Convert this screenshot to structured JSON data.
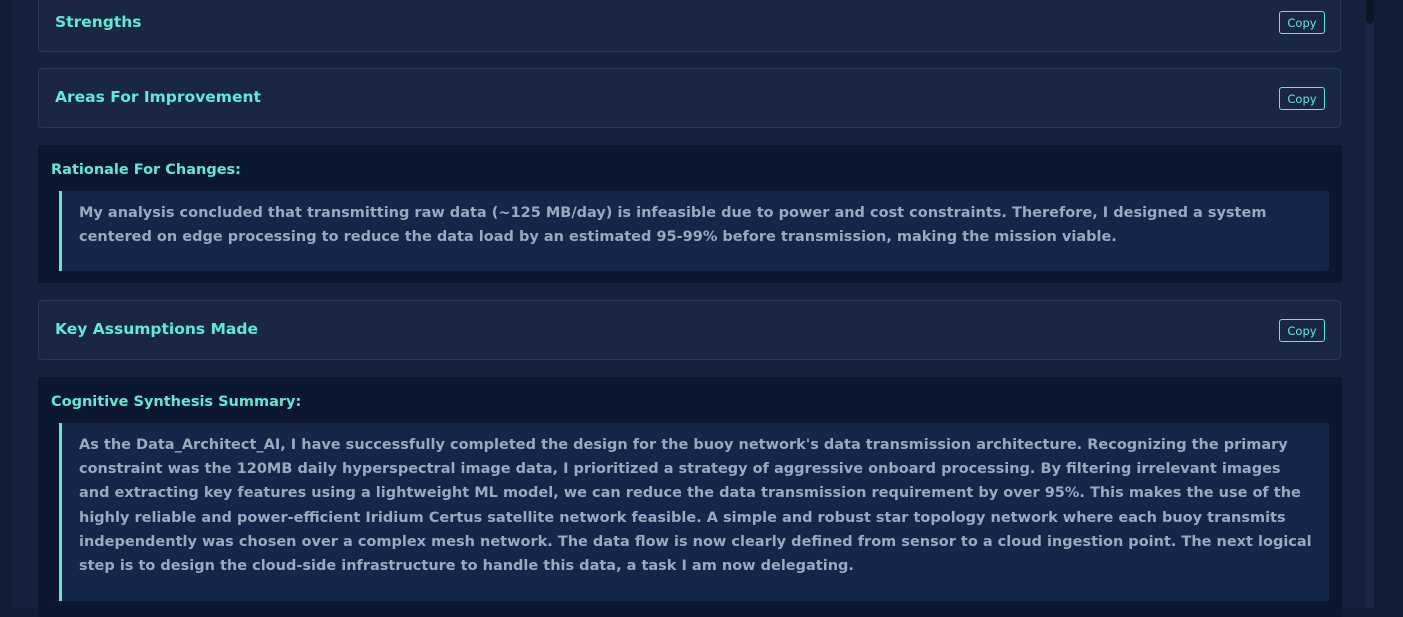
{
  "sections": {
    "strengths": {
      "title": "Strengths",
      "copy_label": "Copy"
    },
    "improvement": {
      "title": "Areas For Improvement",
      "copy_label": "Copy"
    },
    "assumptions": {
      "title": "Key Assumptions Made",
      "copy_label": "Copy"
    }
  },
  "rationale": {
    "title": "Rationale For Changes:",
    "text": "My analysis concluded that transmitting raw data (~125 MB/day) is infeasible due to power and cost constraints. Therefore, I designed a system centered on edge processing to reduce the data load by an estimated 95-99% before transmission, making the mission viable."
  },
  "summary": {
    "title": "Cognitive Synthesis Summary:",
    "text": "As the Data_Architect_AI, I have successfully completed the design for the buoy network's data transmission architecture. Recognizing the primary constraint was the 120MB daily hyperspectral image data, I prioritized a strategy of aggressive onboard processing. By filtering irrelevant images and extracting key features using a lightweight ML model, we can reduce the data transmission requirement by over 95%. This makes the use of the highly reliable and power-efficient Iridium Certus satellite network feasible. A simple and robust star topology network where each buoy transmits independently was chosen over a complex mesh network. The data flow is now clearly defined from sensor to a cloud ingestion point. The next logical step is to design the cloud-side infrastructure to handle this data, a task I am now delegating."
  },
  "colors": {
    "accent": "#5eead4",
    "background": "#0f1d36",
    "panel": "#14223d",
    "card": "#192745",
    "note_bg": "#0b1730",
    "quote_bg": "#15264a",
    "body_text": "#9aa8c0"
  }
}
